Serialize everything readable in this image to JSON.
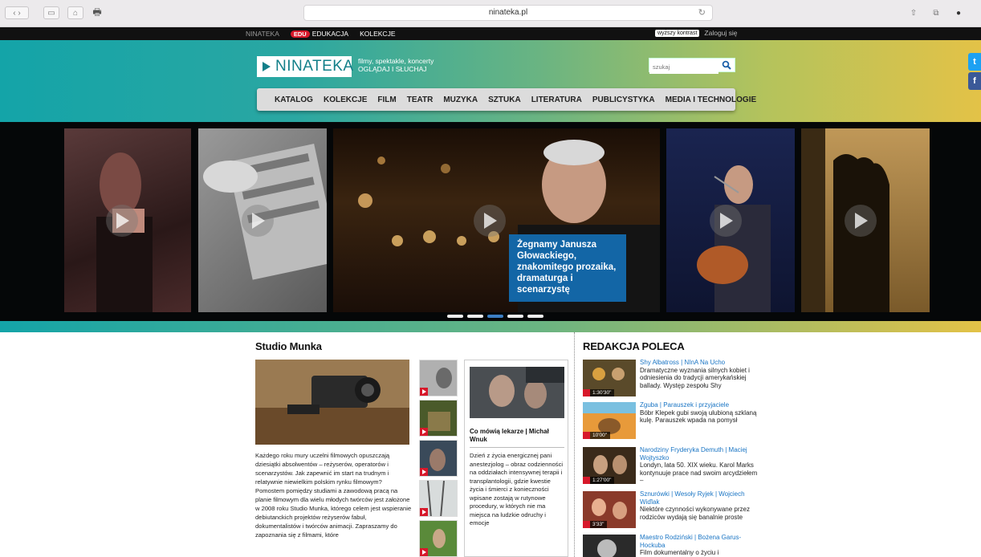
{
  "browser": {
    "url": "ninateka.pl"
  },
  "topbar": {
    "site": "NINATEKA",
    "edu_badge": "EDU",
    "edukacja": "EDUKACJA",
    "kolekcje": "KOLEKCJE",
    "contrast": "wyższy kontrast",
    "login": "Zaloguj się"
  },
  "header": {
    "logo": "NINATEKA",
    "tagline1": "filmy, spektakle, koncerty",
    "tagline2": "OGLĄDAJ I SŁUCHAJ",
    "search_placeholder": "szukaj"
  },
  "nav": [
    "KATALOG",
    "KOLEKCJE",
    "FILM",
    "TEATR",
    "MUZYKA",
    "SZTUKA",
    "LITERATURA",
    "PUBLICYSTYKA",
    "MEDIA I TECHNOLOGIE"
  ],
  "social": {
    "twitter": "t",
    "facebook": "f"
  },
  "carousel": {
    "featured_caption": "Żegnamy Janusza Głowackiego, znakomitego prozaika, dramaturga i scenarzystę",
    "active_dot": 2,
    "dot_count": 5
  },
  "studio": {
    "heading": "Studio Munka",
    "text": "Każdego roku mury uczelni filmowych opuszczają dziesiątki absolwentów – reżyserów, operatorów i scenarzystów. Jak zapewnić im start na trudnym i relatywnie niewielkim polskim rynku filmowym? Pomostem pomiędzy studiami a zawodową pracą na planie filmowym dla wielu młodych twórców jest założone w 2008 roku Studio Munka, którego celem jest wspieranie debiutanckich projektów reżyserów fabuł, dokumentalistów i twórców animacji. Zapraszamy do zapoznania się z filmami, które",
    "card_title": "Co mówią lekarze | Michał Wnuk",
    "card_text": "Dzień z życia energicznej pani anestezjolog – obraz codzienności na oddziałach intensywnej terapii i transplantologii, gdzie kwestie życia i śmierci z konieczności wpisane zostają w rutynowe procedury, w których nie ma miejsca na ludzkie odruchy i emocje"
  },
  "recommended": {
    "heading": "REDAKCJA POLECA",
    "items": [
      {
        "title": "Shy Albatross | NInA Na Ucho",
        "desc": "Dramatyczne wyznania silnych kobiet i odniesienia do tradycji amerykańskiej ballady. Występ zespołu Shy",
        "duration": "1:30'30\""
      },
      {
        "title": "Zguba | Parauszek i przyjaciele",
        "desc": "Bóbr Klepek gubi swoją ulubioną szklaną kulę. Parauszek wpada na pomysł",
        "duration": "10'00\""
      },
      {
        "title": "Narodziny Fryderyka Demuth | Maciej Wojtyszko",
        "desc": "Londyn, lata 50. XIX wieku. Karol Marks kontynuuje prace nad swoim arcydziełem –",
        "duration": "1:27'00\""
      },
      {
        "title": "Sznurówki | Wesoły Ryjek | Wojciech Wiďlak",
        "desc": "Niektóre czynności wykonywane przez rodziców wydają się banalnie proste",
        "duration": "3'33\""
      },
      {
        "title": "Maestro Rodziński | Bożena Garus-Hockuba",
        "desc": "Film dokumentalny o życiu i",
        "duration": ""
      }
    ]
  }
}
